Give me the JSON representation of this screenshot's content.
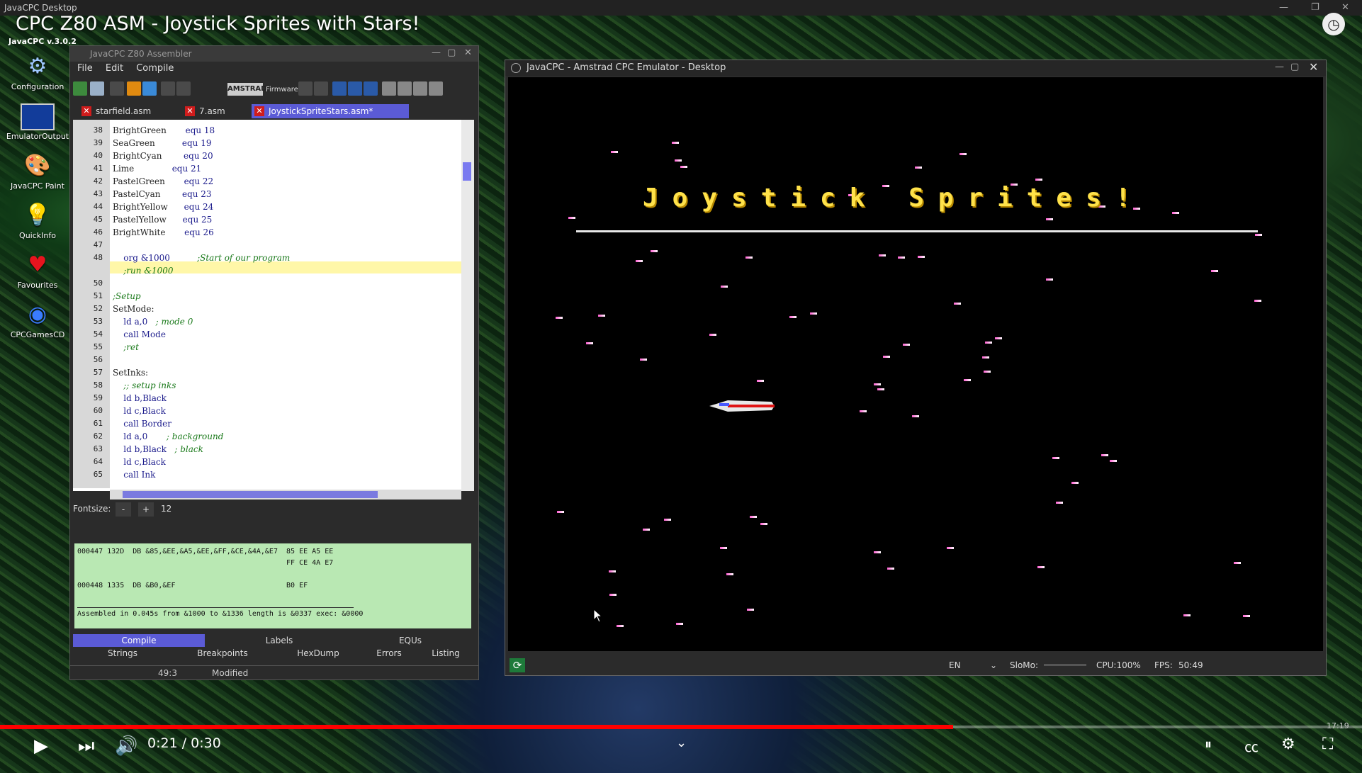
{
  "host_window": {
    "title": "JavaCPC Desktop"
  },
  "video": {
    "title": "CPC Z80 ASM - Joystick Sprites with Stars!",
    "time": "0:21 / 0:30",
    "progress": 0.7
  },
  "desktop": {
    "version": "JavaCPC v.3.0.2",
    "icons": [
      {
        "label": "Configuration"
      },
      {
        "label": "EmulatorOutput"
      },
      {
        "label": "JavaCPC Paint"
      },
      {
        "label": "QuickInfo"
      },
      {
        "label": "Favourites"
      },
      {
        "label": "CPCGamesCD"
      }
    ]
  },
  "assembler": {
    "title": "JavaCPC Z80 Assembler",
    "menu": [
      "File",
      "Edit",
      "Compile"
    ],
    "toolbar": {
      "logo": "AMSTRAD",
      "firmware": "Firmware"
    },
    "tabs": [
      "starfield.asm",
      "7.asm",
      "JoystickSpriteStars.asm*"
    ],
    "line_numbers": [
      "38",
      "39",
      "40",
      "41",
      "42",
      "43",
      "44",
      "45",
      "46",
      "47",
      "48",
      "",
      "50",
      "51",
      "52",
      "53",
      "54",
      "55",
      "56",
      "57",
      "58",
      "59",
      "60",
      "61",
      "62",
      "63",
      "64",
      "65"
    ],
    "code": [
      {
        "l": "BrightGreen       ",
        "k": "equ 18",
        "c": ""
      },
      {
        "l": "SeaGreen          ",
        "k": "equ 19",
        "c": ""
      },
      {
        "l": "BrightCyan        ",
        "k": "equ 20",
        "c": ""
      },
      {
        "l": "Lime              ",
        "k": "equ 21",
        "c": ""
      },
      {
        "l": "PastelGreen       ",
        "k": "equ 22",
        "c": ""
      },
      {
        "l": "PastelCyan        ",
        "k": "equ 23",
        "c": ""
      },
      {
        "l": "BrightYellow      ",
        "k": "equ 24",
        "c": ""
      },
      {
        "l": "PastelYellow      ",
        "k": "equ 25",
        "c": ""
      },
      {
        "l": "BrightWhite       ",
        "k": "equ 26",
        "c": ""
      },
      {
        "l": "",
        "k": "",
        "c": ""
      },
      {
        "l": "    ",
        "k": "org &1000",
        "c": "          ;Start of our program"
      },
      {
        "l": "    ",
        "k": "",
        "c": ";run &1000"
      },
      {
        "l": "",
        "k": "",
        "c": ""
      },
      {
        "l": "",
        "k": "",
        "c": ";Setup"
      },
      {
        "l": "SetMode:",
        "k": "",
        "c": ""
      },
      {
        "l": "    ",
        "k": "ld a,0",
        "c": "   ; mode 0"
      },
      {
        "l": "    ",
        "k": "call",
        "c": ""
      },
      {
        "l": "    ",
        "k": "",
        "c": ";ret"
      },
      {
        "l": "",
        "k": "",
        "c": ""
      },
      {
        "l": "SetInks:",
        "k": "",
        "c": ""
      },
      {
        "l": "    ",
        "k": "",
        "c": ";; setup inks"
      },
      {
        "l": "    ",
        "k": "ld b,Black",
        "c": ""
      },
      {
        "l": "    ",
        "k": "ld c,Black",
        "c": ""
      },
      {
        "l": "    ",
        "k": "call Border",
        "c": ""
      },
      {
        "l": "    ",
        "k": "ld a,0",
        "c": "       ; background"
      },
      {
        "l": "    ",
        "k": "ld b,Black",
        "c": "   ; black"
      },
      {
        "l": "    ",
        "k": "ld c,Black",
        "c": ""
      },
      {
        "l": "    ",
        "k": "call Ink",
        "c": ""
      }
    ],
    "mode_word": "Mode",
    "fontsize": {
      "label": "Fontsize:",
      "minus": "-",
      "plus": "+",
      "value": "12"
    },
    "output": [
      "000447 132D  DB &85,&EE,&A5,&EE,&FF,&CE,&4A,&E7  85 EE A5 EE",
      "                                                 FF CE 4A E7",
      "",
      "000448 1335  DB &B0,&EF                          B0 EF",
      "",
      "Assembled in 0.045s from &1000 to &1336 length is &0337 exec: &0000"
    ],
    "bottom_tabs_row1": [
      "Compile",
      "Labels",
      "EQUs"
    ],
    "bottom_tabs_row2": [
      "Strings",
      "Breakpoints",
      "HexDump",
      "Errors",
      "Listing"
    ],
    "status": {
      "pos": "49:3",
      "state": "Modified"
    }
  },
  "emulator": {
    "title": "JavaCPC - Amstrad CPC Emulator - Desktop",
    "screen_text": "Joystick Sprites!",
    "status": {
      "lang": "EN",
      "slomo": "SloMo:",
      "cpu": "CPU:100%",
      "fps": "FPS:",
      "fps_value": "50:49"
    }
  },
  "taskbar": {
    "clock": "17:19"
  }
}
